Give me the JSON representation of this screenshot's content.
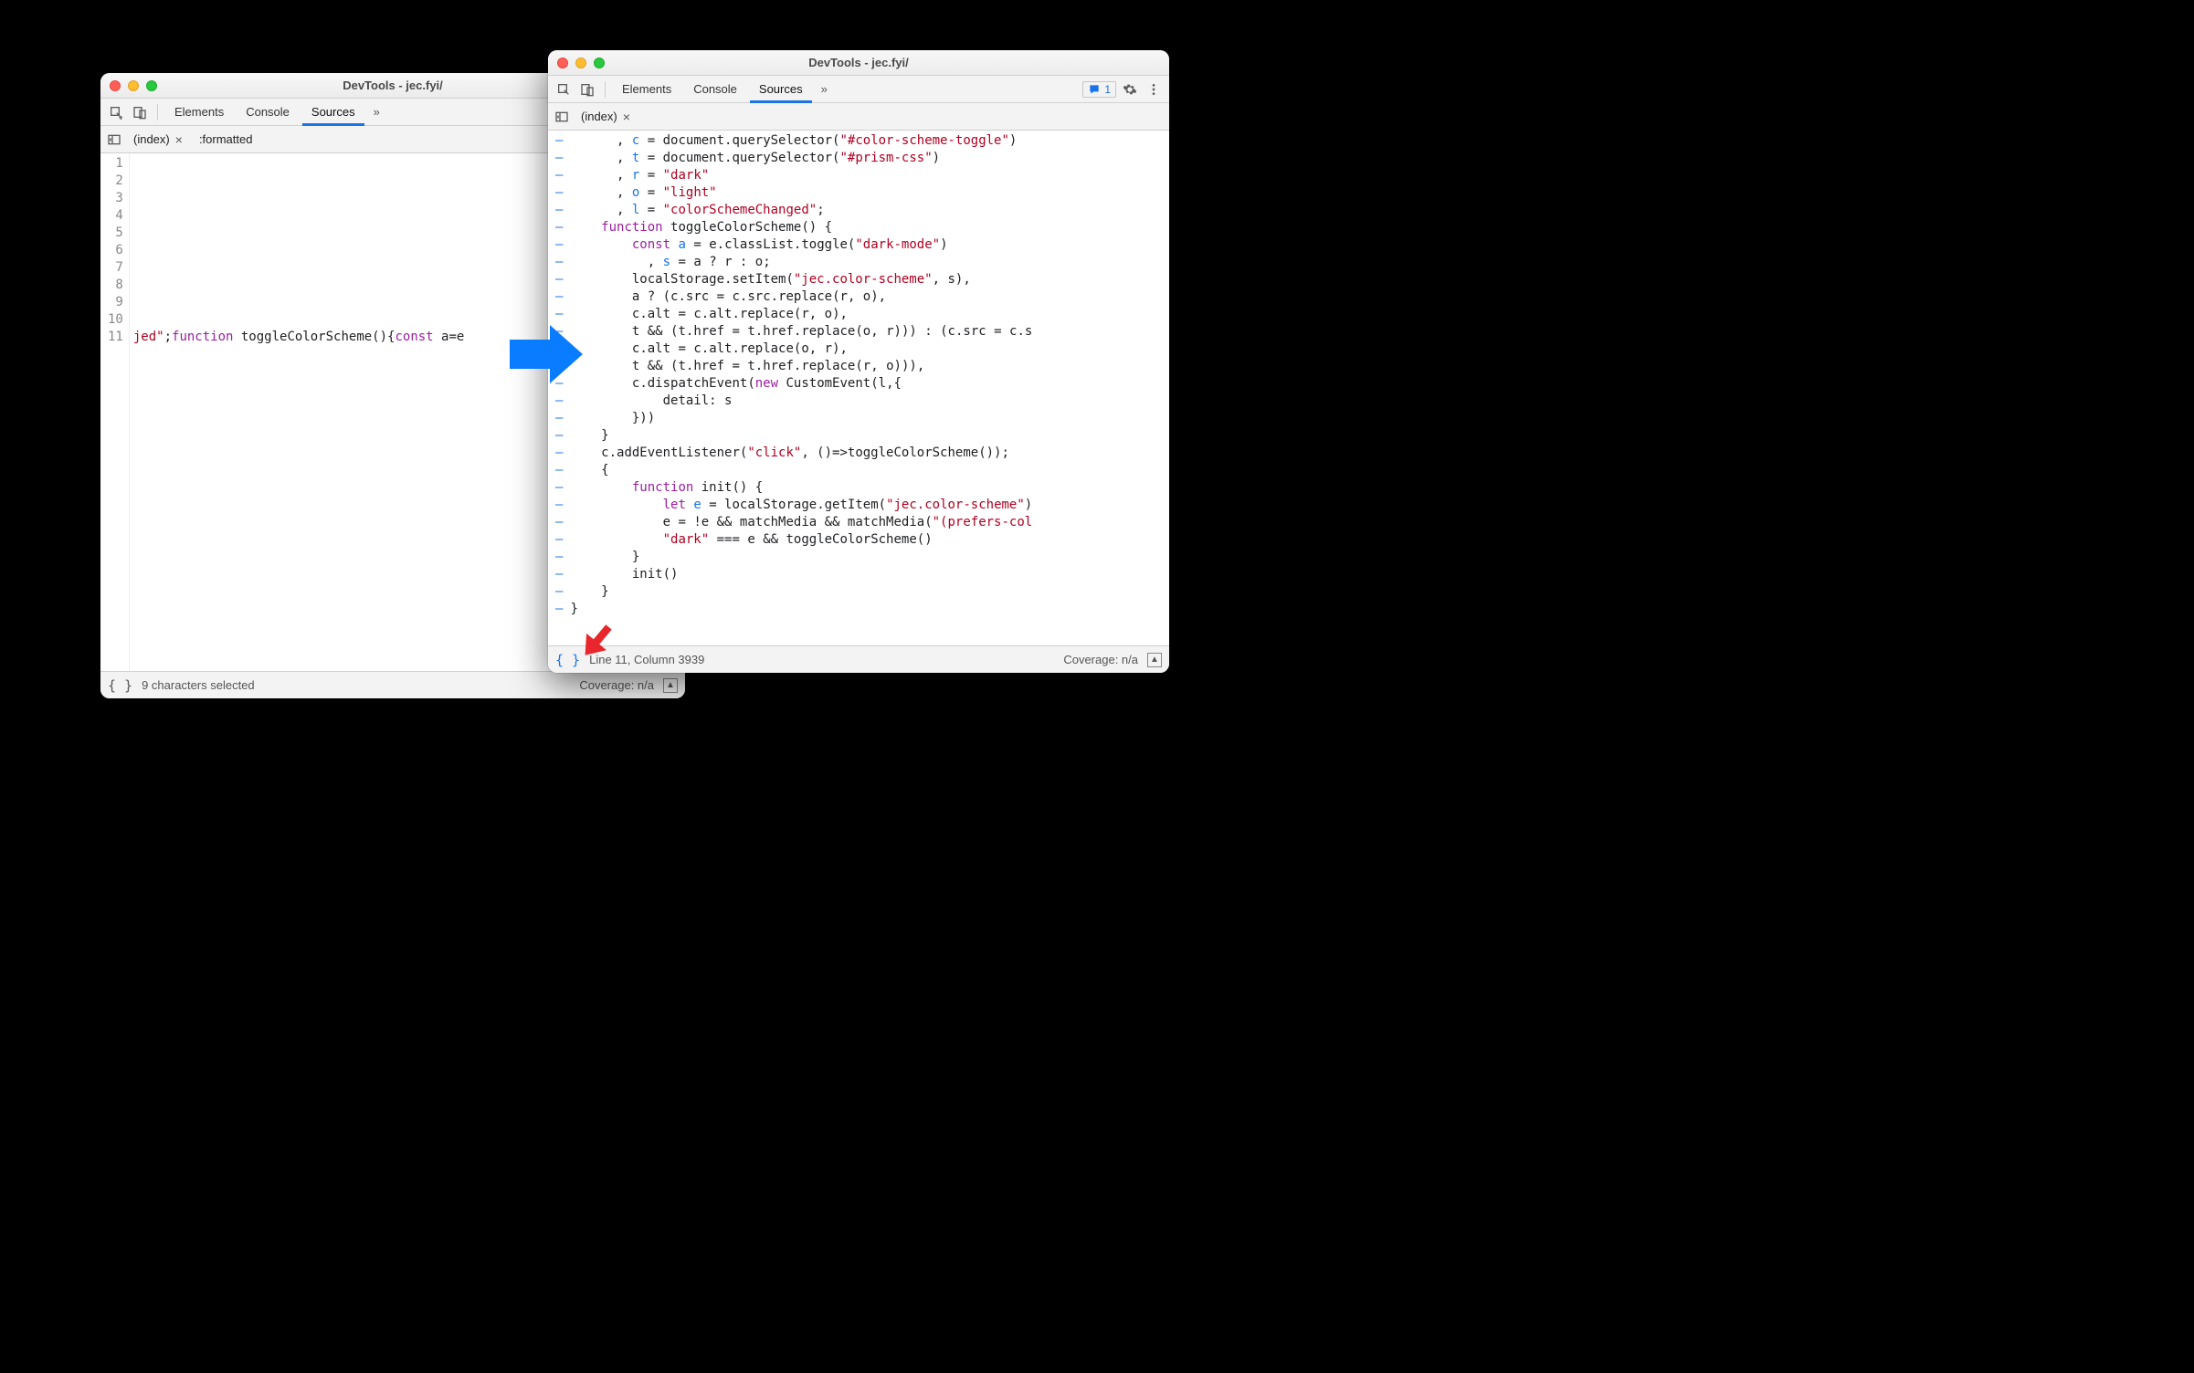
{
  "app_title": "DevTools - jec.fyi/",
  "main_tabs": {
    "elements": "Elements",
    "console": "Console",
    "sources": "Sources"
  },
  "issues_badge": "1",
  "left": {
    "file_tab_index": "(index)",
    "file_tab_formatted": ":formatted",
    "line_numbers": [
      "1",
      "2",
      "3",
      "4",
      "5",
      "6",
      "7",
      "8",
      "9",
      "10",
      "11"
    ],
    "code_line_11_prefix_str": "jed\"",
    "code_line_11_prefix_punc": ";",
    "code_line_11_kw1": "function",
    "code_line_11_fn": " toggleColorScheme(){",
    "code_line_11_kw2": "const",
    "code_line_11_tail": " a=e",
    "status_selection": "9 characters selected",
    "status_coverage": "Coverage: n/a"
  },
  "right": {
    "file_tab_index": "(index)",
    "status_line": "Line 11, Column 3939",
    "status_coverage": "Coverage: n/a",
    "dash_count": 28,
    "code_lines": [
      [
        {
          "t": "      , ",
          "c": "pun"
        },
        {
          "t": "c",
          "c": "id"
        },
        {
          "t": " = ",
          "c": "op"
        },
        {
          "t": "document",
          "c": "obj"
        },
        {
          "t": ".querySelector(",
          "c": "obj"
        },
        {
          "t": "\"#color-scheme-toggle\"",
          "c": "str"
        },
        {
          "t": ")",
          "c": "pun"
        }
      ],
      [
        {
          "t": "      , ",
          "c": "pun"
        },
        {
          "t": "t",
          "c": "id"
        },
        {
          "t": " = ",
          "c": "op"
        },
        {
          "t": "document",
          "c": "obj"
        },
        {
          "t": ".querySelector(",
          "c": "obj"
        },
        {
          "t": "\"#prism-css\"",
          "c": "str"
        },
        {
          "t": ")",
          "c": "pun"
        }
      ],
      [
        {
          "t": "      , ",
          "c": "pun"
        },
        {
          "t": "r",
          "c": "id"
        },
        {
          "t": " = ",
          "c": "op"
        },
        {
          "t": "\"dark\"",
          "c": "str"
        }
      ],
      [
        {
          "t": "      , ",
          "c": "pun"
        },
        {
          "t": "o",
          "c": "id"
        },
        {
          "t": " = ",
          "c": "op"
        },
        {
          "t": "\"light\"",
          "c": "str"
        }
      ],
      [
        {
          "t": "      , ",
          "c": "pun"
        },
        {
          "t": "l",
          "c": "id"
        },
        {
          "t": " = ",
          "c": "op"
        },
        {
          "t": "\"colorSchemeChanged\"",
          "c": "str"
        },
        {
          "t": ";",
          "c": "pun"
        }
      ],
      [
        {
          "t": "    ",
          "c": "pun"
        },
        {
          "t": "function",
          "c": "kw"
        },
        {
          "t": " ",
          "c": "pun"
        },
        {
          "t": "toggleColorScheme",
          "c": "obj"
        },
        {
          "t": "() {",
          "c": "pun"
        }
      ],
      [
        {
          "t": "        ",
          "c": "pun"
        },
        {
          "t": "const",
          "c": "kw"
        },
        {
          "t": " ",
          "c": "pun"
        },
        {
          "t": "a",
          "c": "id"
        },
        {
          "t": " = ",
          "c": "op"
        },
        {
          "t": "e",
          "c": "obj"
        },
        {
          "t": ".classList.toggle(",
          "c": "obj"
        },
        {
          "t": "\"dark-mode\"",
          "c": "str"
        },
        {
          "t": ")",
          "c": "pun"
        }
      ],
      [
        {
          "t": "          , ",
          "c": "pun"
        },
        {
          "t": "s",
          "c": "id"
        },
        {
          "t": " = ",
          "c": "op"
        },
        {
          "t": "a",
          "c": "obj"
        },
        {
          "t": " ? ",
          "c": "op"
        },
        {
          "t": "r",
          "c": "obj"
        },
        {
          "t": " : ",
          "c": "op"
        },
        {
          "t": "o",
          "c": "obj"
        },
        {
          "t": ";",
          "c": "pun"
        }
      ],
      [
        {
          "t": "        localStorage.setItem(",
          "c": "obj"
        },
        {
          "t": "\"jec.color-scheme\"",
          "c": "str"
        },
        {
          "t": ", ",
          "c": "pun"
        },
        {
          "t": "s",
          "c": "obj"
        },
        {
          "t": "),",
          "c": "pun"
        }
      ],
      [
        {
          "t": "        ",
          "c": "pun"
        },
        {
          "t": "a",
          "c": "obj"
        },
        {
          "t": " ? (",
          "c": "op"
        },
        {
          "t": "c",
          "c": "obj"
        },
        {
          "t": ".src = ",
          "c": "obj"
        },
        {
          "t": "c",
          "c": "obj"
        },
        {
          "t": ".src.replace(",
          "c": "obj"
        },
        {
          "t": "r",
          "c": "obj"
        },
        {
          "t": ", ",
          "c": "pun"
        },
        {
          "t": "o",
          "c": "obj"
        },
        {
          "t": "),",
          "c": "pun"
        }
      ],
      [
        {
          "t": "        ",
          "c": "pun"
        },
        {
          "t": "c",
          "c": "obj"
        },
        {
          "t": ".alt = ",
          "c": "obj"
        },
        {
          "t": "c",
          "c": "obj"
        },
        {
          "t": ".alt.replace(",
          "c": "obj"
        },
        {
          "t": "r",
          "c": "obj"
        },
        {
          "t": ", ",
          "c": "pun"
        },
        {
          "t": "o",
          "c": "obj"
        },
        {
          "t": "),",
          "c": "pun"
        }
      ],
      [
        {
          "t": "        ",
          "c": "pun"
        },
        {
          "t": "t",
          "c": "obj"
        },
        {
          "t": " && (",
          "c": "op"
        },
        {
          "t": "t",
          "c": "obj"
        },
        {
          "t": ".href = ",
          "c": "obj"
        },
        {
          "t": "t",
          "c": "obj"
        },
        {
          "t": ".href.replace(",
          "c": "obj"
        },
        {
          "t": "o",
          "c": "obj"
        },
        {
          "t": ", ",
          "c": "pun"
        },
        {
          "t": "r",
          "c": "obj"
        },
        {
          "t": "))) : (",
          "c": "pun"
        },
        {
          "t": "c",
          "c": "obj"
        },
        {
          "t": ".src = ",
          "c": "obj"
        },
        {
          "t": "c",
          "c": "obj"
        },
        {
          "t": ".s",
          "c": "obj"
        }
      ],
      [
        {
          "t": "        ",
          "c": "pun"
        },
        {
          "t": "c",
          "c": "obj"
        },
        {
          "t": ".alt = ",
          "c": "obj"
        },
        {
          "t": "c",
          "c": "obj"
        },
        {
          "t": ".alt.replace(",
          "c": "obj"
        },
        {
          "t": "o",
          "c": "obj"
        },
        {
          "t": ", ",
          "c": "pun"
        },
        {
          "t": "r",
          "c": "obj"
        },
        {
          "t": "),",
          "c": "pun"
        }
      ],
      [
        {
          "t": "        ",
          "c": "pun"
        },
        {
          "t": "t",
          "c": "obj"
        },
        {
          "t": " && (",
          "c": "op"
        },
        {
          "t": "t",
          "c": "obj"
        },
        {
          "t": ".href = ",
          "c": "obj"
        },
        {
          "t": "t",
          "c": "obj"
        },
        {
          "t": ".href.replace(",
          "c": "obj"
        },
        {
          "t": "r",
          "c": "obj"
        },
        {
          "t": ", ",
          "c": "pun"
        },
        {
          "t": "o",
          "c": "obj"
        },
        {
          "t": "))),",
          "c": "pun"
        }
      ],
      [
        {
          "t": "        ",
          "c": "pun"
        },
        {
          "t": "c",
          "c": "obj"
        },
        {
          "t": ".dispatchEvent(",
          "c": "obj"
        },
        {
          "t": "new",
          "c": "kw"
        },
        {
          "t": " CustomEvent(",
          "c": "obj"
        },
        {
          "t": "l",
          "c": "obj"
        },
        {
          "t": ",{",
          "c": "pun"
        }
      ],
      [
        {
          "t": "            detail: ",
          "c": "obj"
        },
        {
          "t": "s",
          "c": "obj"
        }
      ],
      [
        {
          "t": "        }))",
          "c": "pun"
        }
      ],
      [
        {
          "t": "    }",
          "c": "pun"
        }
      ],
      [
        {
          "t": "    ",
          "c": "pun"
        },
        {
          "t": "c",
          "c": "obj"
        },
        {
          "t": ".addEventListener(",
          "c": "obj"
        },
        {
          "t": "\"click\"",
          "c": "str"
        },
        {
          "t": ", ()=>toggleColorScheme());",
          "c": "obj"
        }
      ],
      [
        {
          "t": "    {",
          "c": "pun"
        }
      ],
      [
        {
          "t": "        ",
          "c": "pun"
        },
        {
          "t": "function",
          "c": "kw"
        },
        {
          "t": " ",
          "c": "pun"
        },
        {
          "t": "init",
          "c": "obj"
        },
        {
          "t": "() {",
          "c": "pun"
        }
      ],
      [
        {
          "t": "            ",
          "c": "pun"
        },
        {
          "t": "let",
          "c": "kw"
        },
        {
          "t": " ",
          "c": "pun"
        },
        {
          "t": "e",
          "c": "id"
        },
        {
          "t": " = localStorage.getItem(",
          "c": "obj"
        },
        {
          "t": "\"jec.color-scheme\"",
          "c": "str"
        },
        {
          "t": ")",
          "c": "pun"
        }
      ],
      [
        {
          "t": "            ",
          "c": "pun"
        },
        {
          "t": "e",
          "c": "obj"
        },
        {
          "t": " = !",
          "c": "op"
        },
        {
          "t": "e",
          "c": "obj"
        },
        {
          "t": " && matchMedia && matchMedia(",
          "c": "obj"
        },
        {
          "t": "\"(prefers-col",
          "c": "str"
        }
      ],
      [
        {
          "t": "            ",
          "c": "pun"
        },
        {
          "t": "\"dark\"",
          "c": "str"
        },
        {
          "t": " === ",
          "c": "op"
        },
        {
          "t": "e",
          "c": "obj"
        },
        {
          "t": " && toggleColorScheme()",
          "c": "obj"
        }
      ],
      [
        {
          "t": "        }",
          "c": "pun"
        }
      ],
      [
        {
          "t": "        init()",
          "c": "obj"
        }
      ],
      [
        {
          "t": "    }",
          "c": "pun"
        }
      ],
      [
        {
          "t": "}",
          "c": "pun"
        }
      ]
    ]
  }
}
